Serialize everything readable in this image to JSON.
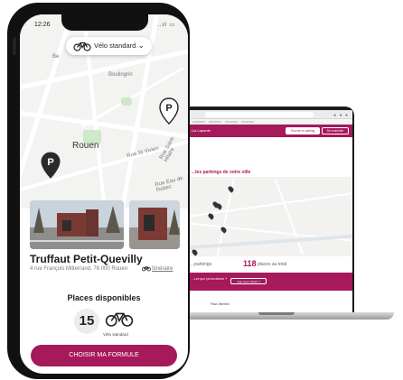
{
  "phone": {
    "status": {
      "time": "12:26",
      "icons": "..ıl ▭"
    },
    "selector": {
      "label": "Vélo standard",
      "bike_icon": "bicycle-icon",
      "chevron_icon": "chevron-down-icon"
    },
    "map": {
      "city_label": "Rouen",
      "labels": [
        "Boulingrin",
        "Be",
        "Rue St Vivien",
        "Rue Saint-Hilaire",
        "Rue Eau de Robec"
      ],
      "pin_icon": "parking-pin-icon"
    },
    "station": {
      "name": "Truffaut Petit-Quevilly",
      "address": "4 rue François Mitterrand, 76 000 Rouen",
      "itinerary_label": "Itinéraire"
    },
    "availability": {
      "title": "Places disponibles",
      "count": "15",
      "bike_type": "Vélo standard"
    },
    "cta_label": "CHOISIR MA FORMULE"
  },
  "laptop": {
    "site_header": {
      "logo": "Lia Lapante",
      "button1": "Trouver un parking",
      "button2": "Se connecter"
    },
    "title": "...les parkings de votre ville",
    "stats": {
      "label": "...parkings",
      "count": "118",
      "unit": "places au total"
    },
    "band": {
      "text": "...t-ce que ça fonctionne ?",
      "button": "Que nous choisir ?"
    },
    "footer_text": "Pass illimités"
  },
  "colors": {
    "brand": "#a6195a",
    "phone_frame": "#111111"
  }
}
